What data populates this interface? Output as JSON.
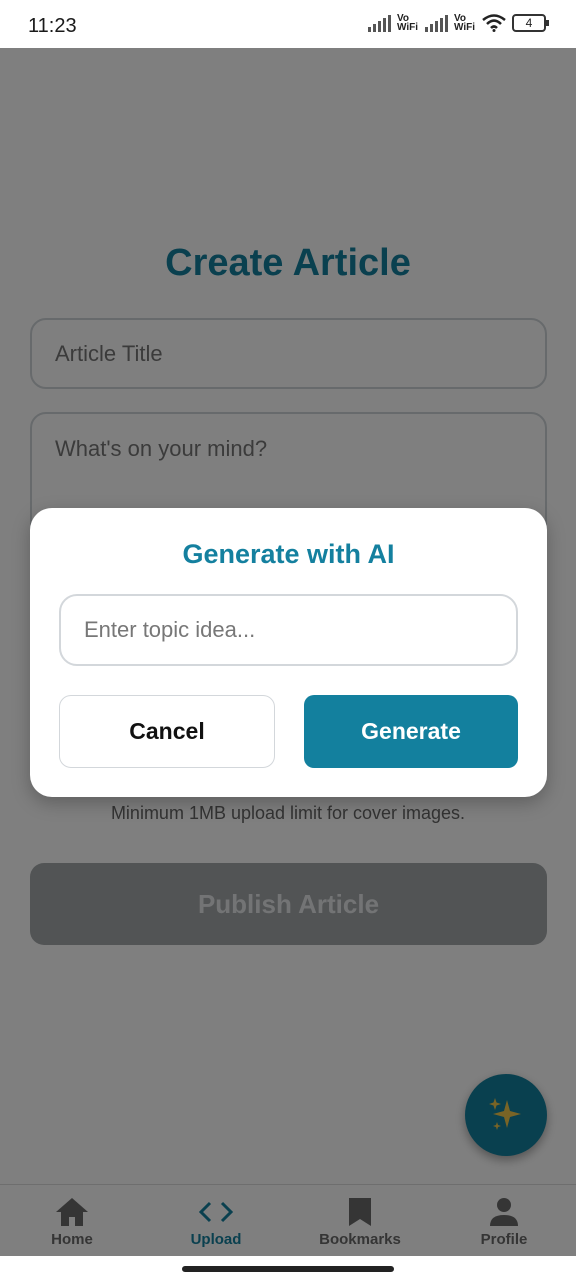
{
  "status_bar": {
    "time": "11:23",
    "network_1": "Vo WiFi",
    "network_2": "Vo WiFi",
    "battery": "4"
  },
  "page": {
    "title": "Create Article",
    "title_placeholder": "Article Title",
    "body_placeholder": "What's on your mind?",
    "upload_note": "Minimum 1MB upload limit for cover images.",
    "publish_label": "Publish Article"
  },
  "fab": {
    "icon": "sparkles-icon"
  },
  "nav": {
    "items": [
      {
        "label": "Home",
        "icon": "home-icon"
      },
      {
        "label": "Upload",
        "icon": "code-icon",
        "active": true
      },
      {
        "label": "Bookmarks",
        "icon": "bookmark-icon"
      },
      {
        "label": "Profile",
        "icon": "person-icon"
      }
    ]
  },
  "modal": {
    "title": "Generate with AI",
    "topic_placeholder": "Enter topic idea...",
    "topic_value": "",
    "cancel_label": "Cancel",
    "generate_label": "Generate"
  },
  "colors": {
    "accent": "#13809e",
    "overlay": "rgba(0,0,0,0.5)",
    "sparkle": "#f2c94c"
  }
}
